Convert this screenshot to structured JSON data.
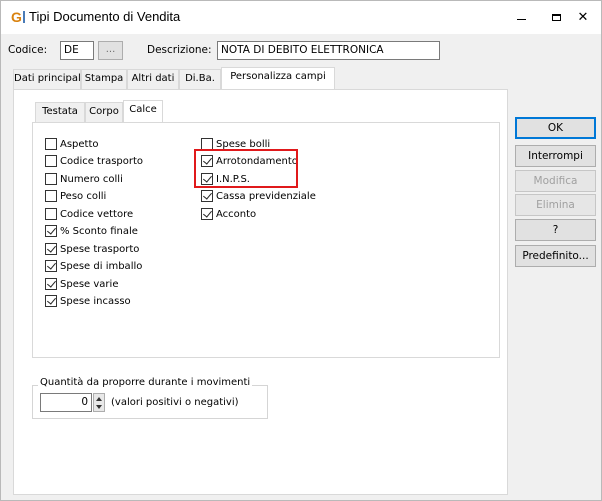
{
  "window": {
    "title": "Tipi Documento di Vendita"
  },
  "header": {
    "codice_label": "Codice:",
    "codice_value": "DE",
    "codice_lookup_label": "...",
    "descrizione_label": "Descrizione:",
    "descrizione_value": "NOTA DI DEBITO ELETTRONICA"
  },
  "main_tabs": [
    {
      "label": "Dati principali",
      "active": false
    },
    {
      "label": "Stampa",
      "active": false
    },
    {
      "label": "Altri dati",
      "active": false
    },
    {
      "label": "Di.Ba.",
      "active": false
    },
    {
      "label": "Personalizza campi",
      "active": true
    }
  ],
  "sub_tabs": [
    {
      "label": "Testata",
      "active": false
    },
    {
      "label": "Corpo",
      "active": false
    },
    {
      "label": "Calce",
      "active": true
    }
  ],
  "checkboxes_left": [
    {
      "label": "Aspetto",
      "checked": false
    },
    {
      "label": "Codice trasporto",
      "checked": false
    },
    {
      "label": "Numero colli",
      "checked": false
    },
    {
      "label": "Peso colli",
      "checked": false
    },
    {
      "label": "Codice vettore",
      "checked": false
    },
    {
      "label": "% Sconto finale",
      "checked": true
    },
    {
      "label": "Spese trasporto",
      "checked": true
    },
    {
      "label": "Spese di imballo",
      "checked": true
    },
    {
      "label": "Spese varie",
      "checked": true
    },
    {
      "label": "Spese incasso",
      "checked": true
    }
  ],
  "checkboxes_right": [
    {
      "label": "Spese bolli",
      "checked": false
    },
    {
      "label": "Arrotondamento",
      "checked": true
    },
    {
      "label": "I.N.P.S.",
      "checked": true
    },
    {
      "label": "Cassa previdenziale",
      "checked": true
    },
    {
      "label": "Acconto",
      "checked": true
    }
  ],
  "quantity_group": {
    "title": "Quantità da proporre durante i movimenti",
    "value": "0",
    "hint": "(valori positivi o negativi)"
  },
  "side_buttons": {
    "ok": "OK",
    "interrompi": "Interrompi",
    "modifica": "Modifica",
    "elimina": "Elimina",
    "help": "?",
    "predefinito": "Predefinito..."
  }
}
